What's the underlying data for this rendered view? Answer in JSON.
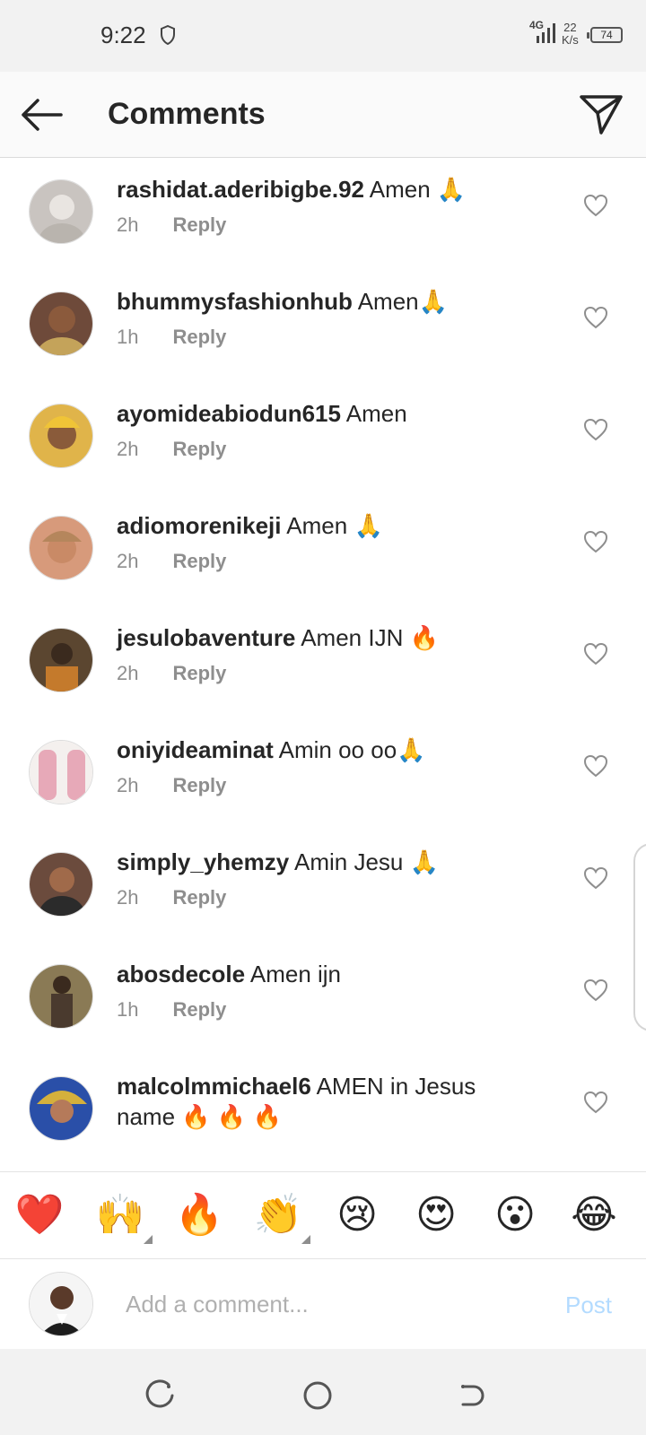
{
  "status_bar": {
    "time": "9:22",
    "network": "4G",
    "speed_value": "22",
    "speed_unit": "K/s",
    "battery": "74"
  },
  "header": {
    "title": "Comments",
    "back_icon": "arrow-left-icon",
    "send_icon": "paper-plane-icon"
  },
  "comments": [
    {
      "username": "rashidat.aderibigbe.92",
      "text": "Amen 🙏",
      "time": "2h",
      "reply": "Reply",
      "avatar_color": "#c9c4c0"
    },
    {
      "username": "bhummysfashionhub",
      "text": "Amen🙏",
      "time": "1h",
      "reply": "Reply",
      "avatar_color": "#6e4a3a"
    },
    {
      "username": "ayomideabiodun615",
      "text": "Amen",
      "time": "2h",
      "reply": "Reply",
      "avatar_color": "#e0b44a"
    },
    {
      "username": "adiomorenikeji",
      "text": "Amen 🙏",
      "time": "2h",
      "reply": "Reply",
      "avatar_color": "#d79a7b"
    },
    {
      "username": "jesulobaventure",
      "text": "Amen IJN 🔥",
      "time": "2h",
      "reply": "Reply",
      "avatar_color": "#5b4630"
    },
    {
      "username": "oniyideaminat",
      "text": "Amin oo oo🙏",
      "time": "2h",
      "reply": "Reply",
      "avatar_color": "#e7a9b8"
    },
    {
      "username": "simply_yhemzy",
      "text": "Amin Jesu 🙏",
      "time": "2h",
      "reply": "Reply",
      "avatar_color": "#6b4b3d"
    },
    {
      "username": "abosdecole",
      "text": "Amen ijn",
      "time": "1h",
      "reply": "Reply",
      "avatar_color": "#8a7a55"
    },
    {
      "username": "malcolmmichael6",
      "text": "AMEN in Jesus name 🔥 🔥 🔥",
      "time": "",
      "reply": "",
      "avatar_color": "#2a4fa8"
    }
  ],
  "reactions": [
    {
      "emoji": "❤️",
      "name": "red-heart"
    },
    {
      "emoji": "🙌",
      "name": "raising-hands",
      "more": true
    },
    {
      "emoji": "🔥",
      "name": "fire"
    },
    {
      "emoji": "👏",
      "name": "clapping-hands",
      "more": true
    },
    {
      "emoji": "😢",
      "name": "crying-face"
    },
    {
      "emoji": "😍",
      "name": "heart-eyes"
    },
    {
      "emoji": "😮",
      "name": "open-mouth"
    },
    {
      "emoji": "😂",
      "name": "tears-of-joy"
    }
  ],
  "composer": {
    "placeholder": "Add a comment...",
    "post_label": "Post"
  },
  "colors": {
    "accent_disabled": "#b3dbff",
    "muted_text": "#8e8e8e",
    "like_icon": "#8e8e8e"
  }
}
